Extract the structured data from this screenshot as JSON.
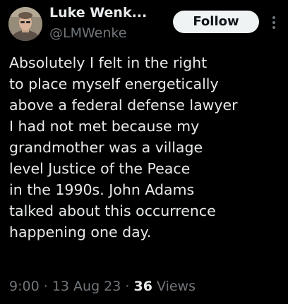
{
  "author": {
    "display_name": "Luke Wenk...",
    "handle": "@LMWenke",
    "avatar_icon": "profile-photo"
  },
  "follow_button": {
    "label": "Follow"
  },
  "more_icon": "more-vertical-icon",
  "tweet": {
    "lines": [
      "Absolutely I felt in the right",
      "to place myself energetically",
      "above a federal defense lawyer",
      "I had not met because my",
      "grandmother was a village",
      "level Justice of the Peace",
      "in the 1990s.  John Adams",
      "talked about this occurrence",
      "happening one day."
    ]
  },
  "meta": {
    "time": "9:00",
    "separator": "·",
    "date": "13 Aug 23",
    "views_count": "36",
    "views_label": "Views"
  },
  "colors": {
    "background": "#000000",
    "text_primary": "#e7e9ea",
    "text_secondary": "#71767b",
    "button_bg": "#eff3f4",
    "button_text": "#0f1419"
  }
}
